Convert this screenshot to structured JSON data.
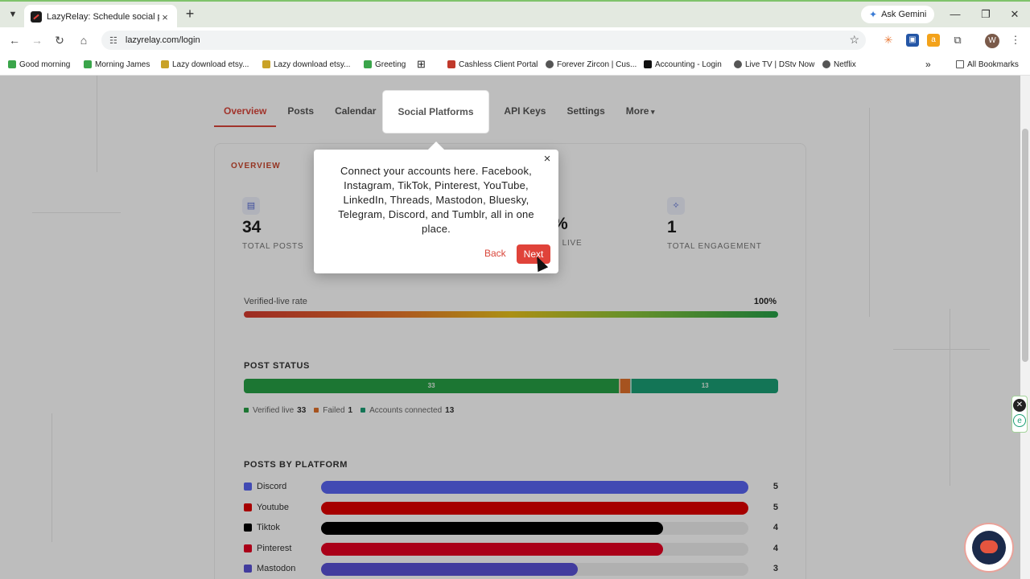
{
  "browser": {
    "tab_title": "LazyRelay: Schedule social posts",
    "gemini_label": "Ask Gemini",
    "url": "lazyrelay.com/login",
    "profile_initial": "W",
    "bookmarks": [
      {
        "label": "Good morning",
        "color": "#3aa54a"
      },
      {
        "label": "Morning James",
        "color": "#3aa54a"
      },
      {
        "label": "Lazy download etsy...",
        "color": "#c9a227"
      },
      {
        "label": "Lazy download etsy...",
        "color": "#c9a227"
      },
      {
        "label": "Greeting",
        "color": "#3aa54a"
      },
      {
        "label": "Cashless Client Portal",
        "color": "#c0392b"
      },
      {
        "label": "Forever Zircon | Cus...",
        "color": "#555555"
      },
      {
        "label": "Accounting - Login",
        "color": "#111111"
      },
      {
        "label": "Live TV | DStv Now",
        "color": "#555555"
      },
      {
        "label": "Netflix",
        "color": "#555555"
      }
    ],
    "all_bookmarks": "All Bookmarks"
  },
  "nav": {
    "tabs": [
      "Overview",
      "Posts",
      "Calendar",
      "Social Platforms",
      "API Keys",
      "Settings",
      "More"
    ]
  },
  "overview": {
    "label": "OVERVIEW",
    "stats": [
      {
        "value": "34",
        "label": "TOTAL POSTS"
      },
      {
        "value": "%",
        "label": "D LIVE"
      },
      {
        "value": "1",
        "label": "TOTAL ENGAGEMENT"
      }
    ],
    "rate_label": "Verified-live rate",
    "rate_value": "100%"
  },
  "post_status": {
    "title": "POST STATUS",
    "segments": [
      {
        "label": "33",
        "value": 33,
        "color": "#27a046"
      },
      {
        "label": "",
        "value": 1,
        "color": "#e0702a"
      },
      {
        "label": "13",
        "value": 13,
        "color": "#1a9e74"
      }
    ],
    "legend": [
      {
        "label": "Verified live",
        "value": "33",
        "color": "#27a046"
      },
      {
        "label": "Failed",
        "value": "1",
        "color": "#e0702a"
      },
      {
        "label": "Accounts connected",
        "value": "13",
        "color": "#1a9e74"
      }
    ]
  },
  "posts_by_platform": {
    "title": "POSTS BY PLATFORM",
    "max": 5,
    "rows": [
      {
        "name": "Discord",
        "value": 5,
        "color": "#5865f2"
      },
      {
        "name": "Youtube",
        "value": 5,
        "color": "#e00000"
      },
      {
        "name": "Tiktok",
        "value": 4,
        "color": "#000000"
      },
      {
        "name": "Pinterest",
        "value": 4,
        "color": "#e60023"
      },
      {
        "name": "Mastodon",
        "value": 3,
        "color": "#5a52d6"
      }
    ]
  },
  "tooltip": {
    "text": "Connect your accounts here. Facebook, Instagram, TikTok, Pinterest, YouTube, LinkedIn, Threads, Mastodon, Bluesky, Telegram, Discord, and Tumblr, all in one place.",
    "back": "Back",
    "next": "Next"
  }
}
